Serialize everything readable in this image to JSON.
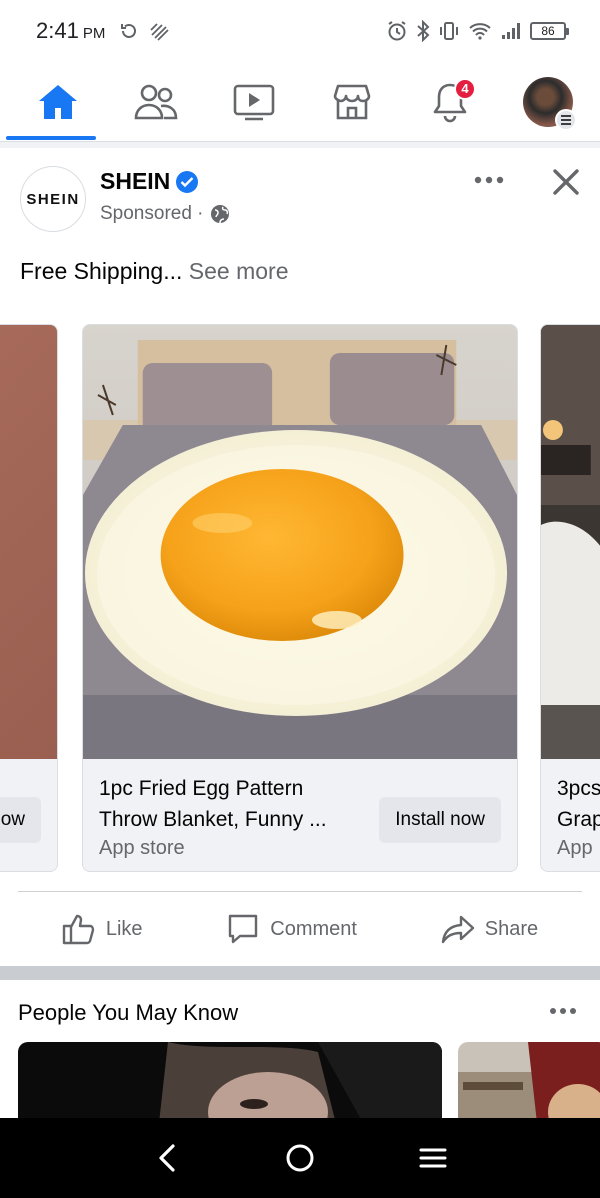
{
  "status_bar": {
    "time": "2:41",
    "ampm": "PM",
    "battery": "86"
  },
  "nav": {
    "notification_count": "4"
  },
  "post": {
    "logo_text": "SHEIN",
    "advertiser": "SHEIN",
    "sponsored_label": "Sponsored ·",
    "text": "Free Shipping...",
    "see_more": "See more"
  },
  "carousel": {
    "cards": [
      {
        "title_line1": "1pc Fried Egg Pattern",
        "title_line2": "Throw Blanket, Funny ...",
        "subtitle": "App store",
        "button": "Install now"
      },
      {
        "title_line1": "3pcs",
        "title_line2": "Grap",
        "subtitle": "App"
      },
      {
        "button": "ow"
      }
    ]
  },
  "actions": {
    "like": "Like",
    "comment": "Comment",
    "share": "Share"
  },
  "pymk": {
    "title": "People You May Know"
  },
  "colors": {
    "brand_blue": "#1877f2",
    "badge_red": "#e41e3f",
    "secondary_text": "#65676b"
  }
}
